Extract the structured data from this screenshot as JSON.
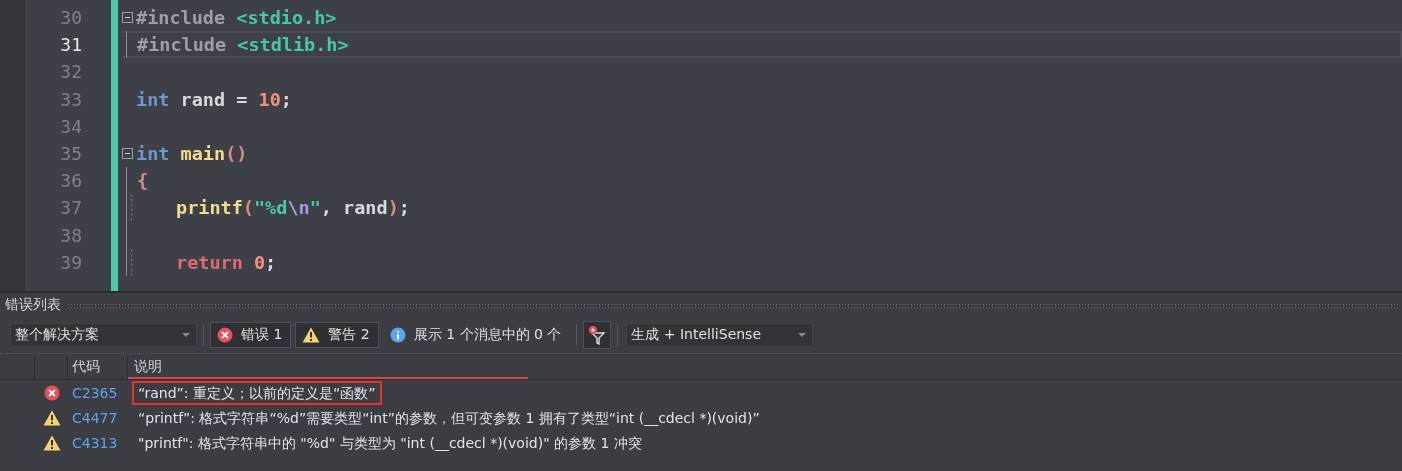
{
  "editor": {
    "lines": [
      {
        "number": "30",
        "current": false,
        "collapsible": true,
        "in_block": false,
        "indented": false,
        "tokens": [
          {
            "kind": "preproc",
            "text": "#include "
          },
          {
            "kind": "header",
            "text": "<stdio.h>"
          }
        ]
      },
      {
        "number": "31",
        "current": true,
        "collapsible": false,
        "in_block": true,
        "indented": false,
        "tokens": [
          {
            "kind": "preproc",
            "text": "#include "
          },
          {
            "kind": "header",
            "text": "<stdlib.h>"
          }
        ]
      },
      {
        "number": "32",
        "current": false,
        "collapsible": false,
        "in_block": false,
        "indented": false
      },
      {
        "number": "33",
        "current": false,
        "collapsible": false,
        "in_block": false,
        "indented": false,
        "tokens": [
          {
            "kind": "keyword",
            "text": "int "
          },
          {
            "kind": "ident",
            "text": "rand "
          },
          {
            "kind": "punct",
            "text": "= "
          },
          {
            "kind": "number",
            "text": "10"
          },
          {
            "kind": "punct",
            "text": ";"
          }
        ]
      },
      {
        "number": "34",
        "current": false,
        "collapsible": false,
        "in_block": false,
        "indented": false
      },
      {
        "number": "35",
        "current": false,
        "collapsible": true,
        "in_block": false,
        "indented": false,
        "tokens": [
          {
            "kind": "keyword",
            "text": "int "
          },
          {
            "kind": "function",
            "text": "main"
          },
          {
            "kind": "paren",
            "text": "()"
          }
        ]
      },
      {
        "number": "36",
        "current": false,
        "collapsible": false,
        "in_block": true,
        "indented": false,
        "tokens": [
          {
            "kind": "paren",
            "text": "{"
          }
        ]
      },
      {
        "number": "37",
        "current": false,
        "collapsible": false,
        "in_block": true,
        "indented": true,
        "tokens": [
          {
            "kind": "function",
            "text": "printf"
          },
          {
            "kind": "paren",
            "text": "("
          },
          {
            "kind": "string",
            "text": "\"%d"
          },
          {
            "kind": "escape",
            "text": "\\n"
          },
          {
            "kind": "string",
            "text": "\""
          },
          {
            "kind": "punct",
            "text": ", "
          },
          {
            "kind": "ident",
            "text": "rand"
          },
          {
            "kind": "paren",
            "text": ")"
          },
          {
            "kind": "punct",
            "text": ";"
          }
        ]
      },
      {
        "number": "38",
        "current": false,
        "collapsible": false,
        "in_block": true,
        "indented": false
      },
      {
        "number": "39",
        "current": false,
        "collapsible": false,
        "in_block": true,
        "indented": true,
        "tokens": [
          {
            "kind": "control",
            "text": "return "
          },
          {
            "kind": "number",
            "text": "0"
          },
          {
            "kind": "punct",
            "text": ";"
          }
        ]
      }
    ]
  },
  "error_list": {
    "title": "错误列表",
    "scope": "整个解决方案",
    "filters": [
      {
        "kind": "error",
        "label": "错误 1",
        "selected": true
      },
      {
        "kind": "warning",
        "label": "警告 2",
        "selected": true
      },
      {
        "kind": "info",
        "label": "展示 1 个消息中的 0 个",
        "selected": false
      }
    ],
    "source": "生成 + IntelliSense",
    "columns": [
      "代码",
      "说明"
    ],
    "rows": [
      {
        "kind": "error",
        "code": "C2365",
        "description": "“rand”: 重定义；以前的定义是“函数”",
        "outlined": true
      },
      {
        "kind": "warning",
        "code": "C4477",
        "description": "“printf”: 格式字符串“%d”需要类型“int”的参数，但可变参数 1 拥有了类型“int (__cdecl *)(void)”",
        "outlined": false
      },
      {
        "kind": "warning",
        "code": "C4313",
        "description": "\"printf\": 格式字符串中的 \"%d\" 与类型为 \"int (__cdecl *)(void)\" 的参数 1 冲突",
        "outlined": false
      }
    ]
  }
}
